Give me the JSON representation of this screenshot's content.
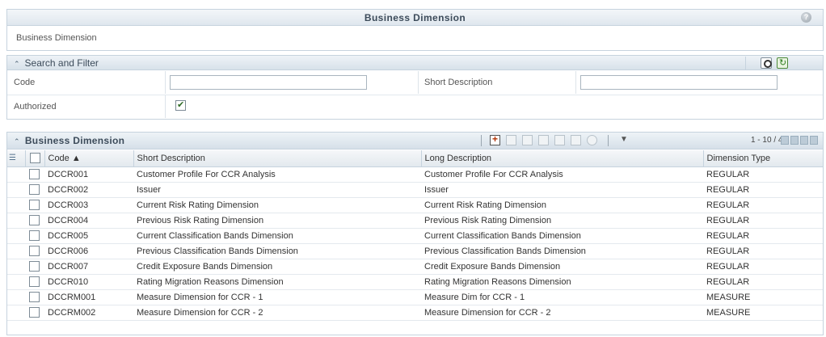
{
  "top_panel": {
    "title": "Business Dimension",
    "subtitle": "Business Dimension",
    "help_icon": "help-icon"
  },
  "search": {
    "title": "Search and Filter",
    "code_label": "Code",
    "code_value": "",
    "short_desc_label": "Short Description",
    "short_desc_value": "",
    "authorized_label": "Authorized",
    "authorized_checked": true
  },
  "grid": {
    "title": "Business Dimension",
    "pager_text": "1 - 10 / 49",
    "columns": [
      "Code ▲",
      "Short Description",
      "Long Description",
      "Dimension Type"
    ],
    "rows": [
      [
        "DCCR001",
        "Customer Profile For CCR Analysis",
        "Customer Profile For CCR Analysis",
        "REGULAR"
      ],
      [
        "DCCR002",
        "Issuer",
        "Issuer",
        "REGULAR"
      ],
      [
        "DCCR003",
        "Current Risk Rating Dimension",
        "Current Risk Rating Dimension",
        "REGULAR"
      ],
      [
        "DCCR004",
        "Previous Risk Rating Dimension",
        "Previous Risk Rating Dimension",
        "REGULAR"
      ],
      [
        "DCCR005",
        "Current Classification Bands Dimension",
        "Current Classification Bands Dimension",
        "REGULAR"
      ],
      [
        "DCCR006",
        "Previous Classification Bands Dimension",
        "Previous Classification Bands Dimension",
        "REGULAR"
      ],
      [
        "DCCR007",
        "Credit Exposure Bands Dimension",
        "Credit Exposure Bands Dimension",
        "REGULAR"
      ],
      [
        "DCCR010",
        "Rating Migration Reasons Dimension",
        "Rating Migration Reasons Dimension",
        "REGULAR"
      ],
      [
        "DCCRM001",
        "Measure Dimension for CCR - 1",
        "Measure Dim for CCR - 1",
        "MEASURE"
      ],
      [
        "DCCRM002",
        "Measure Dimension for CCR - 2",
        "Measure Dimension for CCR - 2",
        "MEASURE"
      ]
    ]
  }
}
